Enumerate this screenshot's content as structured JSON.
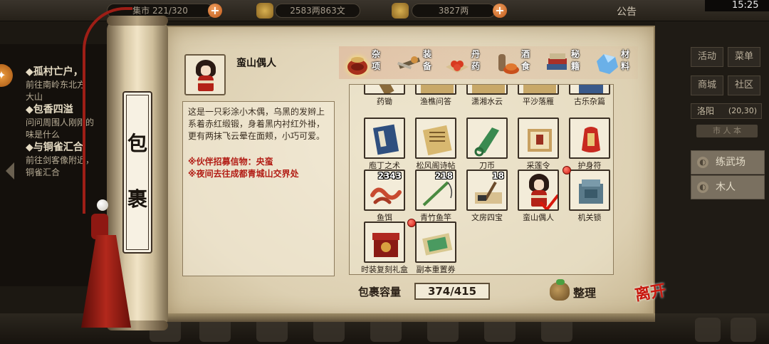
{
  "topbar": {
    "storage_partial": "集市 221/320",
    "money": "2583两863文",
    "ingots": "3827两",
    "announcement": "公告",
    "time": "15:25"
  },
  "quests": [
    {
      "title": "◆孤村亡户，",
      "desc": [
        "前往南岭东北方",
        "大山"
      ]
    },
    {
      "title": "◆包香四溢",
      "desc": [
        "问问周围人刚刚的",
        "味是什么"
      ]
    },
    {
      "title": "◆与铜雀汇合",
      "desc": [
        "前往剑客像附近，",
        "铜雀汇合"
      ]
    }
  ],
  "right_panel": {
    "buttons": [
      "活动",
      "菜单",
      "商城",
      "社区"
    ],
    "city": "洛阳",
    "coords": "(20,30)",
    "city_tab": "市 人 本",
    "npcs": [
      "练武场",
      "木人"
    ]
  },
  "scroll_title": [
    "包",
    "裹"
  ],
  "selected_item": {
    "name": "蛮山偶人",
    "description": "这是一只彩涂小木偶，乌黑的发辫上系着赤红缎锻，身着黑内衬红外褂，更有两抹飞云晕在面颊，小巧可爱。",
    "notes": [
      "※伙伴招募信物：央蛮",
      "※夜间去往成都青城山交界处"
    ]
  },
  "tabs": [
    {
      "label": "杂项",
      "icon": "sundries-icon",
      "active": true
    },
    {
      "label": "装备",
      "icon": "equipment-icon",
      "active": false
    },
    {
      "label": "丹药",
      "icon": "pills-icon",
      "active": false
    },
    {
      "label": "酒食",
      "icon": "food-wine-icon",
      "active": false
    },
    {
      "label": "秘籍",
      "icon": "books-icon",
      "active": false
    },
    {
      "label": "材料",
      "icon": "materials-icon",
      "active": false
    }
  ],
  "items_partial_row": [
    "药锄",
    "渔樵问答",
    "潇湘水云",
    "平沙落雁",
    "古乐杂篇"
  ],
  "items": [
    {
      "name": "庖丁之术",
      "icon": "book-icon",
      "qty": ""
    },
    {
      "name": "松风阁诗帖",
      "icon": "scroll-icon",
      "qty": ""
    },
    {
      "name": "刀币",
      "icon": "knife-coin-icon",
      "qty": ""
    },
    {
      "name": "采莲令",
      "icon": "manual-icon",
      "qty": ""
    },
    {
      "name": "护身符",
      "icon": "amulet-icon",
      "qty": ""
    },
    {
      "name": "鱼饵",
      "icon": "worm-bait-icon",
      "qty": "2343"
    },
    {
      "name": "青竹鱼竿",
      "icon": "fishing-rod-icon",
      "qty": "218"
    },
    {
      "name": "文房四宝",
      "icon": "writing-set-icon",
      "qty": "18"
    },
    {
      "name": "蛮山偶人",
      "icon": "doll-icon",
      "qty": "",
      "new": true,
      "selected": true
    },
    {
      "name": "机关锁",
      "icon": "mechanism-lock-icon",
      "qty": ""
    },
    {
      "name": "时装复刻礼盒",
      "icon": "gift-box-icon",
      "qty": ""
    },
    {
      "name": "副本重置券",
      "icon": "reset-ticket-icon",
      "qty": "",
      "new": true
    }
  ],
  "footer": {
    "capacity_label": "包裹容量",
    "capacity_value": "374/415",
    "sort_label": "整理",
    "leave_label": "离开"
  }
}
